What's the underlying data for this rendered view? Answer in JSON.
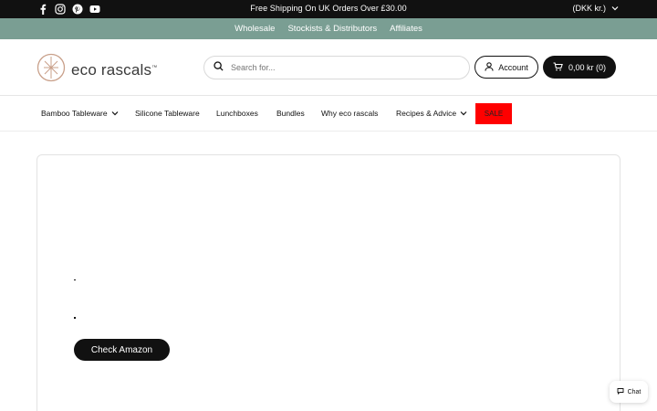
{
  "topbar": {
    "social": [
      "facebook-icon",
      "instagram-icon",
      "pinterest-icon",
      "youtube-icon"
    ],
    "message": "Free Shipping On UK Orders Over £30.00",
    "currency": "(DKK kr.)"
  },
  "linkbar": {
    "links": [
      "Wholesale",
      "Stockists & Distributors",
      "Affiliates"
    ],
    "color": "#7a9e93"
  },
  "header": {
    "logo_text": "eco rascals",
    "logo_tm": "™",
    "search_placeholder": "Search for...",
    "account_label": "Account",
    "cart_label": "0,00 kr (0)"
  },
  "nav": {
    "items": [
      "Bamboo Tableware",
      "Silicone Tableware",
      "Lunchboxes",
      "Bundles",
      "Why eco rascals",
      "Recipes & Advice"
    ],
    "sale_label": "SALE",
    "sale_color": "#ff0000"
  },
  "content": {
    "dot1": ".",
    "dot2": "•",
    "button_label": "Check Amazon"
  },
  "chat": {
    "label": "Chat"
  }
}
